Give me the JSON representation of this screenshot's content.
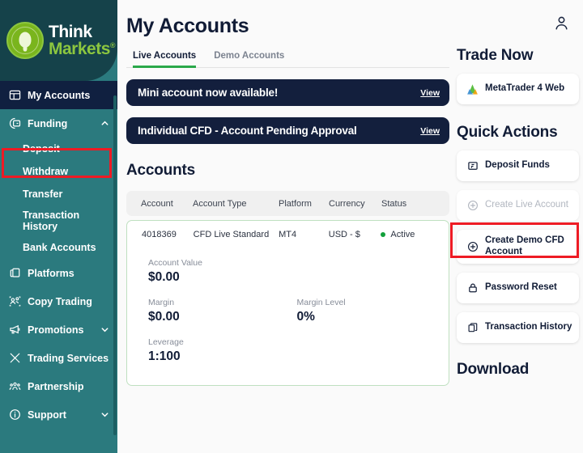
{
  "brand": {
    "name_line1": "Think",
    "name_line2": "Markets",
    "trademark": "®",
    "teal": "#2b7a7e",
    "dark_navy": "#102040",
    "green": "#8cc63f",
    "highlight_red": "#ee1b24"
  },
  "sidebar": {
    "items": [
      {
        "label": "My Accounts",
        "icon": "grid-icon",
        "active": true,
        "expandable": false
      },
      {
        "label": "Funding",
        "icon": "wallet-icon",
        "active": false,
        "expandable": true,
        "chevron": "chevron-up-icon"
      }
    ],
    "funding_children": [
      {
        "label": "Deposit",
        "highlighted": true
      },
      {
        "label": "Withdraw",
        "highlighted": false
      },
      {
        "label": "Transfer",
        "highlighted": false
      },
      {
        "label": "Transaction History",
        "highlighted": false
      },
      {
        "label": "Bank Accounts",
        "highlighted": false
      }
    ],
    "items_lower": [
      {
        "label": "Platforms",
        "icon": "windows-icon",
        "expandable": false
      },
      {
        "label": "Copy Trading",
        "icon": "people-icon",
        "expandable": false
      },
      {
        "label": "Promotions",
        "icon": "megaphone-icon",
        "expandable": true,
        "chevron": "chevron-down-icon"
      },
      {
        "label": "Trading Services",
        "icon": "tools-icon",
        "expandable": false
      },
      {
        "label": "Partnership",
        "icon": "group-icon",
        "expandable": false
      },
      {
        "label": "Support",
        "icon": "info-icon",
        "expandable": true,
        "chevron": "chevron-down-icon"
      }
    ]
  },
  "topbar": {
    "account_icon": "user-icon"
  },
  "main": {
    "page_title": "My Accounts",
    "tabs": [
      {
        "label": "Live Accounts",
        "active": true
      },
      {
        "label": "Demo Accounts",
        "active": false
      }
    ],
    "banners": [
      {
        "text": "Mini account now available!",
        "link": "View"
      },
      {
        "text": "Individual CFD - Account Pending Approval",
        "link": "View"
      }
    ],
    "accounts_section_title": "Accounts",
    "table": {
      "columns": [
        "Account",
        "Account Type",
        "Platform",
        "Currency",
        "Status"
      ],
      "rows": [
        {
          "account": "4018369",
          "account_type": "CFD Live Standard",
          "platform": "MT4",
          "currency": "USD - $",
          "status": "Active",
          "status_color": "#12a03b"
        }
      ]
    },
    "stats": [
      {
        "label": "Account Value",
        "value": "$0.00"
      },
      {
        "label": "Margin",
        "value": "$0.00"
      },
      {
        "label": "Margin Level",
        "value": "0%"
      },
      {
        "label": "Leverage",
        "value": "1:100"
      }
    ]
  },
  "right": {
    "trade_now_title": "Trade Now",
    "trade_now_items": [
      {
        "label": "MetaTrader 4 Web",
        "icon": "metatrader-icon"
      }
    ],
    "quick_actions_title": "Quick Actions",
    "quick_actions": [
      {
        "label": "Deposit Funds",
        "icon": "wallet-icon",
        "disabled": false,
        "highlighted": true
      },
      {
        "label": "Create Live Account",
        "icon": "plus-circle-icon",
        "disabled": true,
        "highlighted": false
      },
      {
        "label": "Create Demo CFD Account",
        "icon": "plus-circle-icon",
        "disabled": false,
        "highlighted": false
      },
      {
        "label": "Password Reset",
        "icon": "lock-icon",
        "disabled": false,
        "highlighted": false
      },
      {
        "label": "Transaction History",
        "icon": "documents-icon",
        "disabled": false,
        "highlighted": false
      }
    ],
    "download_title": "Download"
  }
}
